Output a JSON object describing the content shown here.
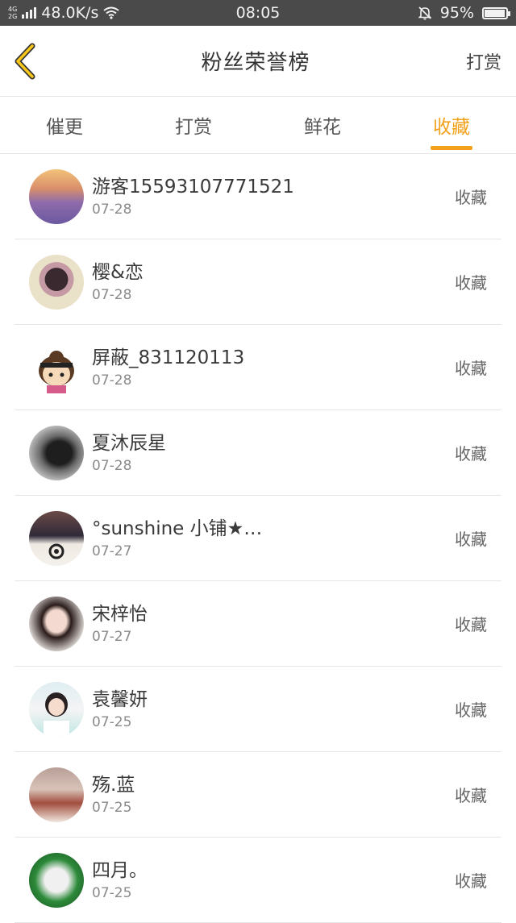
{
  "status_bar": {
    "network_top": "4G",
    "network_bottom": "2G",
    "speed": "48.0K/s",
    "time": "08:05",
    "battery": "95%",
    "battery_level": 0.95
  },
  "header": {
    "title": "粉丝荣誉榜",
    "action": "打赏"
  },
  "tabs": [
    {
      "label": "催更"
    },
    {
      "label": "打赏"
    },
    {
      "label": "鲜花"
    },
    {
      "label": "收藏"
    }
  ],
  "active_tab": 3,
  "fans": [
    {
      "name": "游客15593107771521",
      "date": "07-28",
      "action": "收藏"
    },
    {
      "name": "樱&恋",
      "date": "07-28",
      "action": "收藏"
    },
    {
      "name": "屏蔽_831120113",
      "date": "07-28",
      "action": "收藏"
    },
    {
      "name": "夏沐辰星",
      "date": "07-28",
      "action": "收藏"
    },
    {
      "name": "°sunshine 小铺★…",
      "date": "07-27",
      "action": "收藏"
    },
    {
      "name": "宋梓怡",
      "date": "07-27",
      "action": "收藏"
    },
    {
      "name": "袁馨妍",
      "date": "07-25",
      "action": "收藏"
    },
    {
      "name": "殇.蓝",
      "date": "07-25",
      "action": "收藏"
    },
    {
      "name": "四月。",
      "date": "07-25",
      "action": "收藏"
    }
  ],
  "colors": {
    "accent": "#f2a11a",
    "status_bar": "#4a4a4a"
  }
}
